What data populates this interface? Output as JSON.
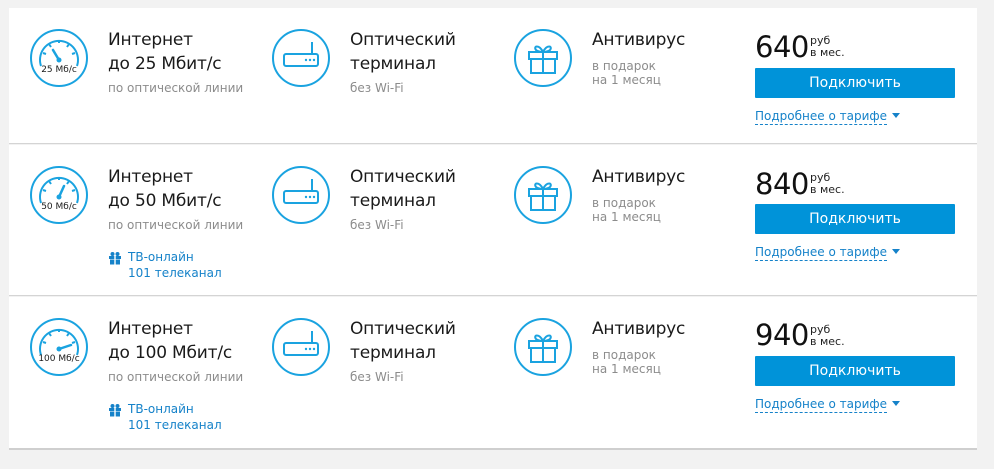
{
  "colors": {
    "accent": "#0093d9",
    "link": "#1582c9",
    "icon_stroke": "#1aa3e0"
  },
  "tariffs": [
    {
      "speed_badge": "25 Мб/с",
      "internet_title_1": "Интернет",
      "internet_title_2": "до 25 Мбит/с",
      "internet_sub": "по оптической линии",
      "terminal_title_1": "Оптический",
      "terminal_title_2": "терминал",
      "terminal_sub": "без Wi-Fi",
      "antivirus_title": "Антивирус",
      "antivirus_sub_1": "в подарок",
      "antivirus_sub_2": "на 1 месяц",
      "price": "640",
      "price_unit_1": "руб",
      "price_unit_2": "в мес.",
      "connect_label": "Подключить",
      "more_label": "Подробнее о тарифе"
    },
    {
      "speed_badge": "50 Мб/с",
      "internet_title_1": "Интернет",
      "internet_title_2": "до 50 Мбит/с",
      "internet_sub": "по оптической линии",
      "tv_line_1": "ТВ-онлайн",
      "tv_line_2": "101 телеканал",
      "terminal_title_1": "Оптический",
      "terminal_title_2": "терминал",
      "terminal_sub": "без Wi-Fi",
      "antivirus_title": "Антивирус",
      "antivirus_sub_1": "в подарок",
      "antivirus_sub_2": "на 1 месяц",
      "price": "840",
      "price_unit_1": "руб",
      "price_unit_2": "в мес.",
      "connect_label": "Подключить",
      "more_label": "Подробнее о тарифе"
    },
    {
      "speed_badge": "100 Мб/с",
      "internet_title_1": "Интернет",
      "internet_title_2": "до 100 Мбит/с",
      "internet_sub": "по оптической линии",
      "tv_line_1": "ТВ-онлайн",
      "tv_line_2": "101 телеканал",
      "terminal_title_1": "Оптический",
      "terminal_title_2": "терминал",
      "terminal_sub": "без Wi-Fi",
      "antivirus_title": "Антивирус",
      "antivirus_sub_1": "в подарок",
      "antivirus_sub_2": "на 1 месяц",
      "price": "940",
      "price_unit_1": "руб",
      "price_unit_2": "в мес.",
      "connect_label": "Подключить",
      "more_label": "Подробнее о тарифе"
    }
  ]
}
